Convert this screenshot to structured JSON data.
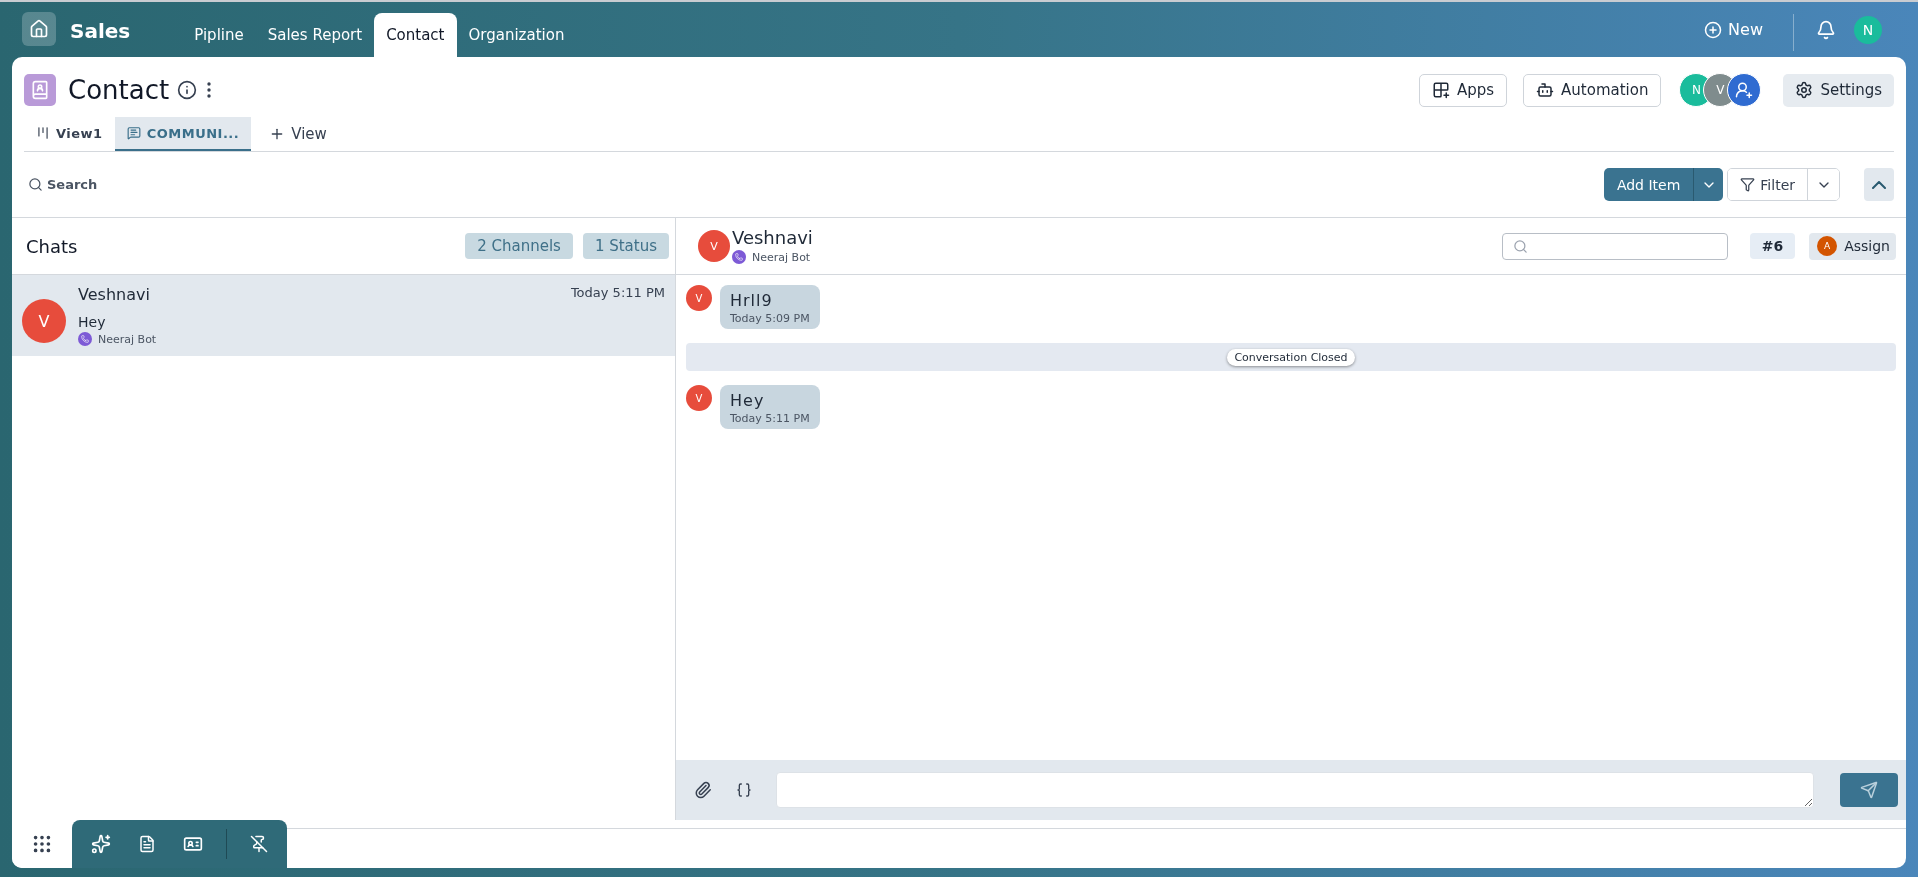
{
  "app": {
    "name": "Sales"
  },
  "nav_tabs": [
    {
      "label": "Pipline",
      "selected": false
    },
    {
      "label": "Sales Report",
      "selected": false
    },
    {
      "label": "Contact",
      "selected": true
    },
    {
      "label": "Organization",
      "selected": false
    }
  ],
  "nav_actions": {
    "new_label": "New",
    "user_initial": "N"
  },
  "page": {
    "title": "Contact",
    "buttons": [
      {
        "kind": "apps",
        "label": "Apps"
      },
      {
        "kind": "automation",
        "label": "Automation"
      }
    ],
    "members": [
      {
        "initial": "N",
        "color": "#1abc9c"
      },
      {
        "initial": "V",
        "color": "#7f8c8d"
      }
    ],
    "settings_label": "Settings"
  },
  "views": [
    {
      "label": "View1",
      "selected": false,
      "kind": "board"
    },
    {
      "label": "COMMUNI...",
      "selected": true,
      "kind": "chat"
    }
  ],
  "add_view_label": "View",
  "toolbar": {
    "search_label": "Search",
    "add_item_label": "Add Item",
    "filter_label": "Filter"
  },
  "chats": {
    "title": "Chats",
    "badges": [
      "2 Channels",
      "1 Status"
    ],
    "items": [
      {
        "initial": "V",
        "name": "Veshnavi",
        "time": "Today 5:11 PM",
        "preview": "Hey",
        "channel": "Neeraj Bot",
        "selected": true
      }
    ]
  },
  "conversation": {
    "initial": "V",
    "name": "Veshnavi",
    "channel": "Neeraj Bot",
    "ticket": "#6",
    "assign_initial": "A",
    "assign_label": "Assign",
    "messages": [
      {
        "kind": "message",
        "initial": "V",
        "text": "Hrll9",
        "time": "Today 5:09 PM"
      },
      {
        "kind": "event",
        "text": "Conversation Closed"
      },
      {
        "kind": "message",
        "initial": "V",
        "text": "Hey",
        "time": "Today 5:11 PM"
      }
    ]
  }
}
